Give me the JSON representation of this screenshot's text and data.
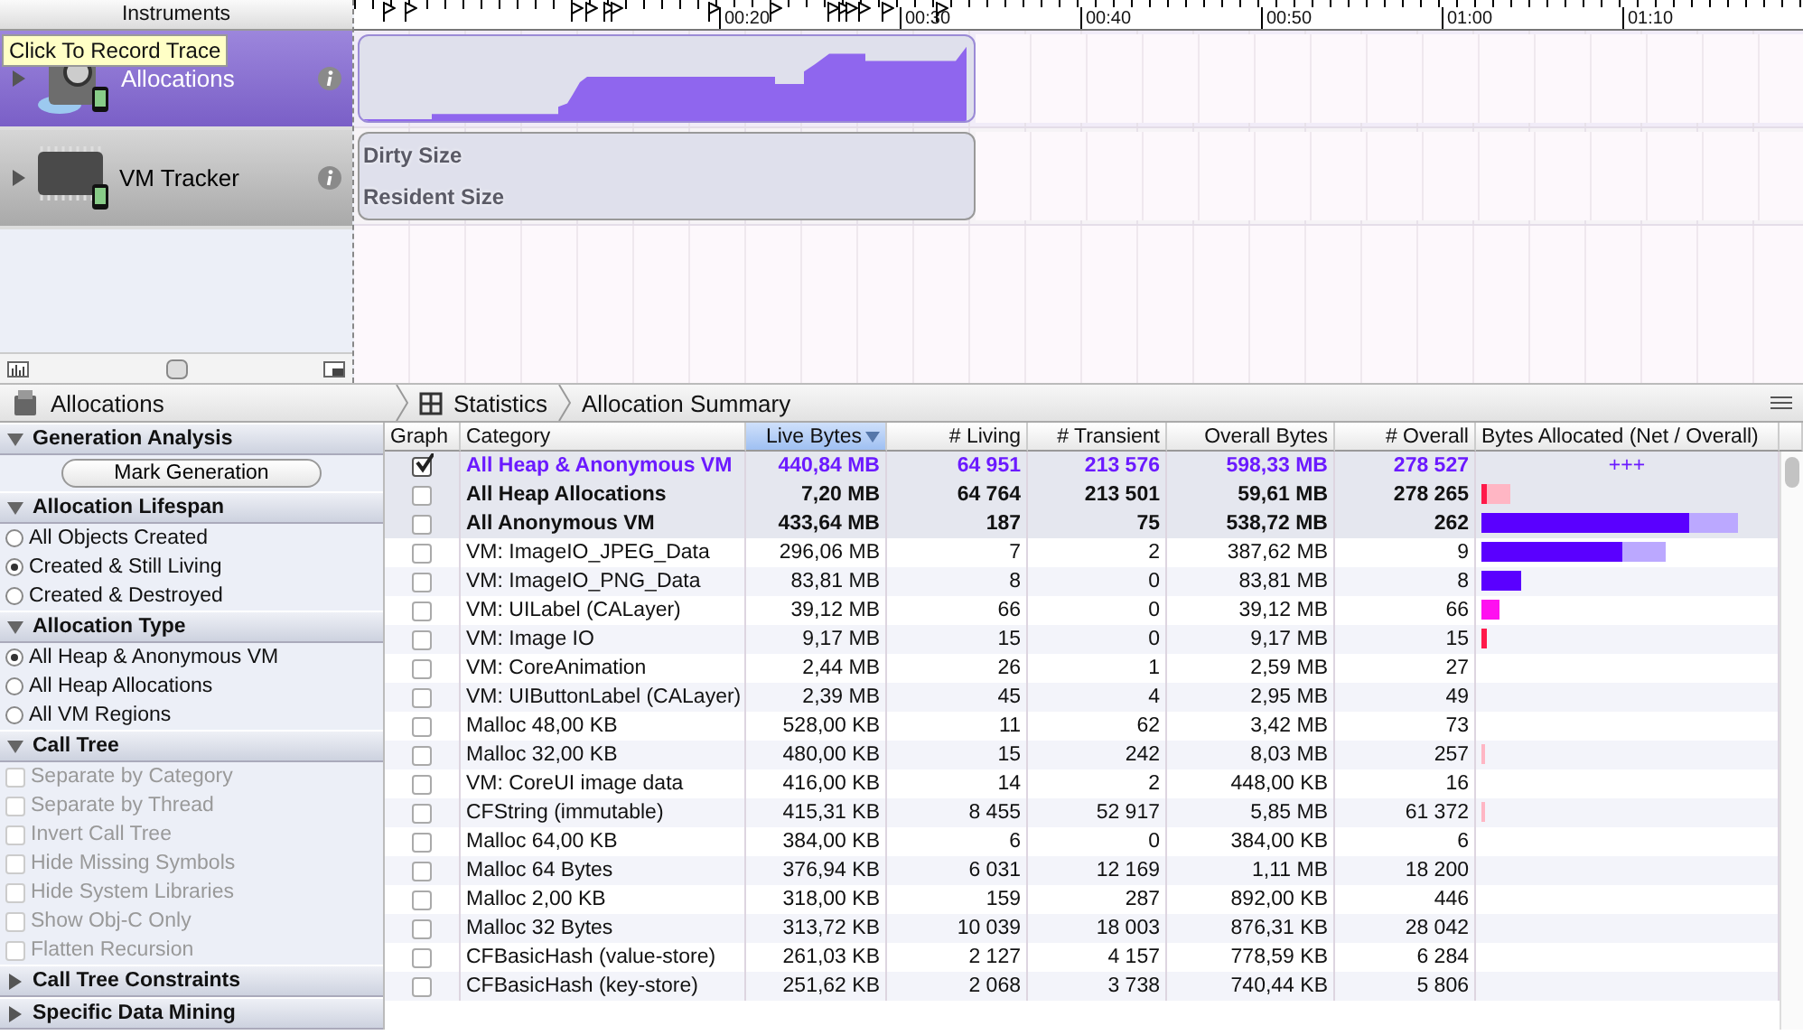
{
  "instruments_header": "Instruments",
  "ruler": {
    "labels": [
      "00:20",
      "00:30",
      "00:40",
      "00:50",
      "01:00",
      "01:10"
    ]
  },
  "tooltip": "Click To Record Trace",
  "tracks": [
    {
      "kind": "allocations",
      "name": "Allocations",
      "selected": true
    },
    {
      "kind": "vm",
      "name": "VM Tracker",
      "selected": false,
      "graph_labels": [
        "Dirty Size",
        "Resident Size"
      ]
    }
  ],
  "detail_bar": {
    "instrument": "Allocations",
    "breadcrumbs": [
      "Statistics",
      "Allocation Summary"
    ]
  },
  "sidebar": [
    {
      "title": "Generation Analysis",
      "expanded": true,
      "items": [
        {
          "kind": "button",
          "label": "Mark Generation"
        }
      ]
    },
    {
      "title": "Allocation Lifespan",
      "expanded": true,
      "items": [
        {
          "kind": "radio",
          "label": "All Objects Created",
          "selected": false
        },
        {
          "kind": "radio",
          "label": "Created & Still Living",
          "selected": true
        },
        {
          "kind": "radio",
          "label": "Created & Destroyed",
          "selected": false
        }
      ]
    },
    {
      "title": "Allocation Type",
      "expanded": true,
      "items": [
        {
          "kind": "radio",
          "label": "All Heap & Anonymous VM",
          "selected": true
        },
        {
          "kind": "radio",
          "label": "All Heap Allocations",
          "selected": false
        },
        {
          "kind": "radio",
          "label": "All VM Regions",
          "selected": false
        }
      ]
    },
    {
      "title": "Call Tree",
      "expanded": true,
      "items": [
        {
          "kind": "checkbox",
          "label": "Separate by Category",
          "checked": false,
          "disabled": true
        },
        {
          "kind": "checkbox",
          "label": "Separate by Thread",
          "checked": false,
          "disabled": true
        },
        {
          "kind": "checkbox",
          "label": "Invert Call Tree",
          "checked": false,
          "disabled": true
        },
        {
          "kind": "checkbox",
          "label": "Hide Missing Symbols",
          "checked": false,
          "disabled": true
        },
        {
          "kind": "checkbox",
          "label": "Hide System Libraries",
          "checked": false,
          "disabled": true
        },
        {
          "kind": "checkbox",
          "label": "Show Obj-C Only",
          "checked": false,
          "disabled": true
        },
        {
          "kind": "checkbox",
          "label": "Flatten Recursion",
          "checked": false,
          "disabled": true
        }
      ]
    },
    {
      "title": "Call Tree Constraints",
      "expanded": false
    },
    {
      "title": "Specific Data Mining",
      "expanded": false
    }
  ],
  "table": {
    "columns": [
      {
        "label": "Graph",
        "sorted": false
      },
      {
        "label": "Category",
        "sorted": false
      },
      {
        "label": "Live Bytes",
        "sorted": true
      },
      {
        "label": "# Living",
        "sorted": false
      },
      {
        "label": "# Transient",
        "sorted": false
      },
      {
        "label": "Overall Bytes",
        "sorted": false
      },
      {
        "label": "# Overall",
        "sorted": false
      },
      {
        "label": "Bytes Allocated (Net / Overall)",
        "sorted": false
      }
    ],
    "rows": [
      {
        "kind": "highlight",
        "checked": true,
        "category": "All Heap & Anonymous VM",
        "live_bytes": "440,84 MB",
        "living": "64 951",
        "transient": "213 576",
        "overall_bytes": "598,33 MB",
        "overall_count": "278 527",
        "graph_text": "+++"
      },
      {
        "kind": "total",
        "checked": false,
        "category": "All Heap Allocations",
        "live_bytes": "7,20 MB",
        "living": "64 764",
        "transient": "213 501",
        "overall_bytes": "59,61 MB",
        "overall_count": "278 265",
        "net": {
          "level": 0.02,
          "color": "#ff1a4a"
        },
        "overall": {
          "level": 0.1,
          "color": "#ffb6c4"
        }
      },
      {
        "kind": "total",
        "checked": false,
        "category": "All Anonymous VM",
        "live_bytes": "433,64 MB",
        "living": "187",
        "transient": "75",
        "overall_bytes": "538,72 MB",
        "overall_count": "262",
        "net": {
          "level": 0.72,
          "color": "#5a00ff"
        },
        "overall": {
          "level": 0.89,
          "color": "#bba8ff"
        }
      },
      {
        "kind": "entry",
        "checked": false,
        "category": "VM: ImageIO_JPEG_Data",
        "live_bytes": "296,06 MB",
        "living": "7",
        "transient": "2",
        "overall_bytes": "387,62 MB",
        "overall_count": "9",
        "net": {
          "level": 0.49,
          "color": "#5a00ff"
        },
        "overall": {
          "level": 0.64,
          "color": "#bba8ff"
        }
      },
      {
        "kind": "entry",
        "checked": false,
        "category": "VM: ImageIO_PNG_Data",
        "live_bytes": "83,81 MB",
        "living": "8",
        "transient": "0",
        "overall_bytes": "83,81 MB",
        "overall_count": "8",
        "net": {
          "level": 0.14,
          "color": "#5a00ff"
        }
      },
      {
        "kind": "entry",
        "checked": false,
        "category": "VM: UILabel (CALayer)",
        "live_bytes": "39,12 MB",
        "living": "66",
        "transient": "0",
        "overall_bytes": "39,12 MB",
        "overall_count": "66",
        "net": {
          "level": 0.06,
          "color": "#ff10f0"
        }
      },
      {
        "kind": "entry",
        "checked": false,
        "category": "VM: Image IO",
        "live_bytes": "9,17 MB",
        "living": "15",
        "transient": "0",
        "overall_bytes": "9,17 MB",
        "overall_count": "15",
        "net": {
          "level": 0.02,
          "color": "#ff1a4a"
        }
      },
      {
        "kind": "entry",
        "checked": false,
        "category": "VM: CoreAnimation",
        "live_bytes": "2,44 MB",
        "living": "26",
        "transient": "1",
        "overall_bytes": "2,59 MB",
        "overall_count": "27"
      },
      {
        "kind": "entry",
        "checked": false,
        "category": "VM: UIButtonLabel (CALayer)",
        "live_bytes": "2,39 MB",
        "living": "45",
        "transient": "4",
        "overall_bytes": "2,95 MB",
        "overall_count": "49"
      },
      {
        "kind": "entry",
        "checked": false,
        "category": "Malloc 48,00 KB",
        "live_bytes": "528,00 KB",
        "living": "11",
        "transient": "62",
        "overall_bytes": "3,42 MB",
        "overall_count": "73"
      },
      {
        "kind": "entry",
        "checked": false,
        "category": "Malloc 32,00 KB",
        "live_bytes": "480,00 KB",
        "living": "15",
        "transient": "242",
        "overall_bytes": "8,03 MB",
        "overall_count": "257",
        "overall": {
          "level": 0.01,
          "color": "#ffb6c4"
        }
      },
      {
        "kind": "entry",
        "checked": false,
        "category": "VM: CoreUI image data",
        "live_bytes": "416,00 KB",
        "living": "14",
        "transient": "2",
        "overall_bytes": "448,00 KB",
        "overall_count": "16"
      },
      {
        "kind": "entry",
        "checked": false,
        "category": "CFString (immutable)",
        "live_bytes": "415,31 KB",
        "living": "8 455",
        "transient": "52 917",
        "overall_bytes": "5,85 MB",
        "overall_count": "61 372",
        "overall": {
          "level": 0.01,
          "color": "#ffb6c4"
        }
      },
      {
        "kind": "entry",
        "checked": false,
        "category": "Malloc 64,00 KB",
        "live_bytes": "384,00 KB",
        "living": "6",
        "transient": "0",
        "overall_bytes": "384,00 KB",
        "overall_count": "6"
      },
      {
        "kind": "entry",
        "checked": false,
        "category": "Malloc 64 Bytes",
        "live_bytes": "376,94 KB",
        "living": "6 031",
        "transient": "12 169",
        "overall_bytes": "1,11 MB",
        "overall_count": "18 200"
      },
      {
        "kind": "entry",
        "checked": false,
        "category": "Malloc 2,00 KB",
        "live_bytes": "318,00 KB",
        "living": "159",
        "transient": "287",
        "overall_bytes": "892,00 KB",
        "overall_count": "446"
      },
      {
        "kind": "entry",
        "checked": false,
        "category": "Malloc 32 Bytes",
        "live_bytes": "313,72 KB",
        "living": "10 039",
        "transient": "18 003",
        "overall_bytes": "876,31 KB",
        "overall_count": "28 042"
      },
      {
        "kind": "entry",
        "checked": false,
        "category": "CFBasicHash (value-store)",
        "live_bytes": "261,03 KB",
        "living": "2 127",
        "transient": "4 157",
        "overall_bytes": "778,59 KB",
        "overall_count": "6 284"
      },
      {
        "kind": "entry",
        "checked": false,
        "category": "CFBasicHash (key-store)",
        "live_bytes": "251,62 KB",
        "living": "2 068",
        "transient": "3 738",
        "overall_bytes": "740,44 KB",
        "overall_count": "5 806"
      }
    ]
  }
}
